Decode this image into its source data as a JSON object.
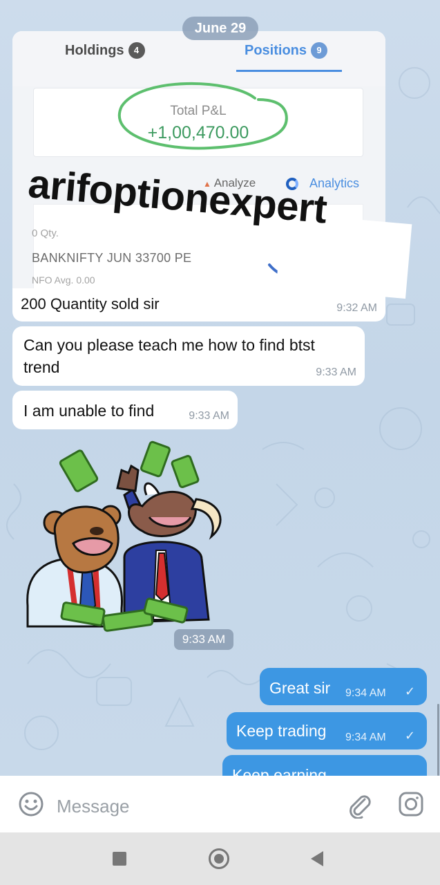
{
  "date_separator": "June 29",
  "photo_message": {
    "tabs": [
      {
        "label": "Holdings",
        "count": "4"
      },
      {
        "label": "Positions",
        "count": "9"
      }
    ],
    "pnl_label": "Total P&L",
    "pnl_value": "+1,00,470.00",
    "analyze_label": "Analyze",
    "analytics_label": "Analytics",
    "position_qty": "0 Qty.",
    "position_symbol": "BANKNIFTY JUN 33700 PE",
    "position_exchange": "NFO  Avg. 0.00",
    "watermark": "arifoptionexpert",
    "caption": "200 Quantity sold sir",
    "time": "9:32 AM"
  },
  "incoming_messages": [
    {
      "lines": [
        "Can you please teach me how to find btst",
        "trend"
      ],
      "time": "9:33 AM"
    },
    {
      "lines": [
        "I am unable to find"
      ],
      "time": "9:33 AM"
    }
  ],
  "sticker": {
    "time": "9:33 AM"
  },
  "outgoing_messages": [
    {
      "text": "Great sir",
      "time": "9:34 AM"
    },
    {
      "text": "Keep trading",
      "time": "9:34 AM"
    },
    {
      "text": "Keep earning",
      "time": ""
    }
  ],
  "input": {
    "placeholder": "Message"
  },
  "icons": {
    "emoji": "smiley-icon",
    "attach": "paperclip-icon",
    "camera": "instagram-camera-icon"
  },
  "colors": {
    "outgoing_bubble": "#3d97e3",
    "pnl_green": "#3c9a5f",
    "tab_active": "#4a8ee0",
    "wallpaper": "#c9d9ea"
  }
}
